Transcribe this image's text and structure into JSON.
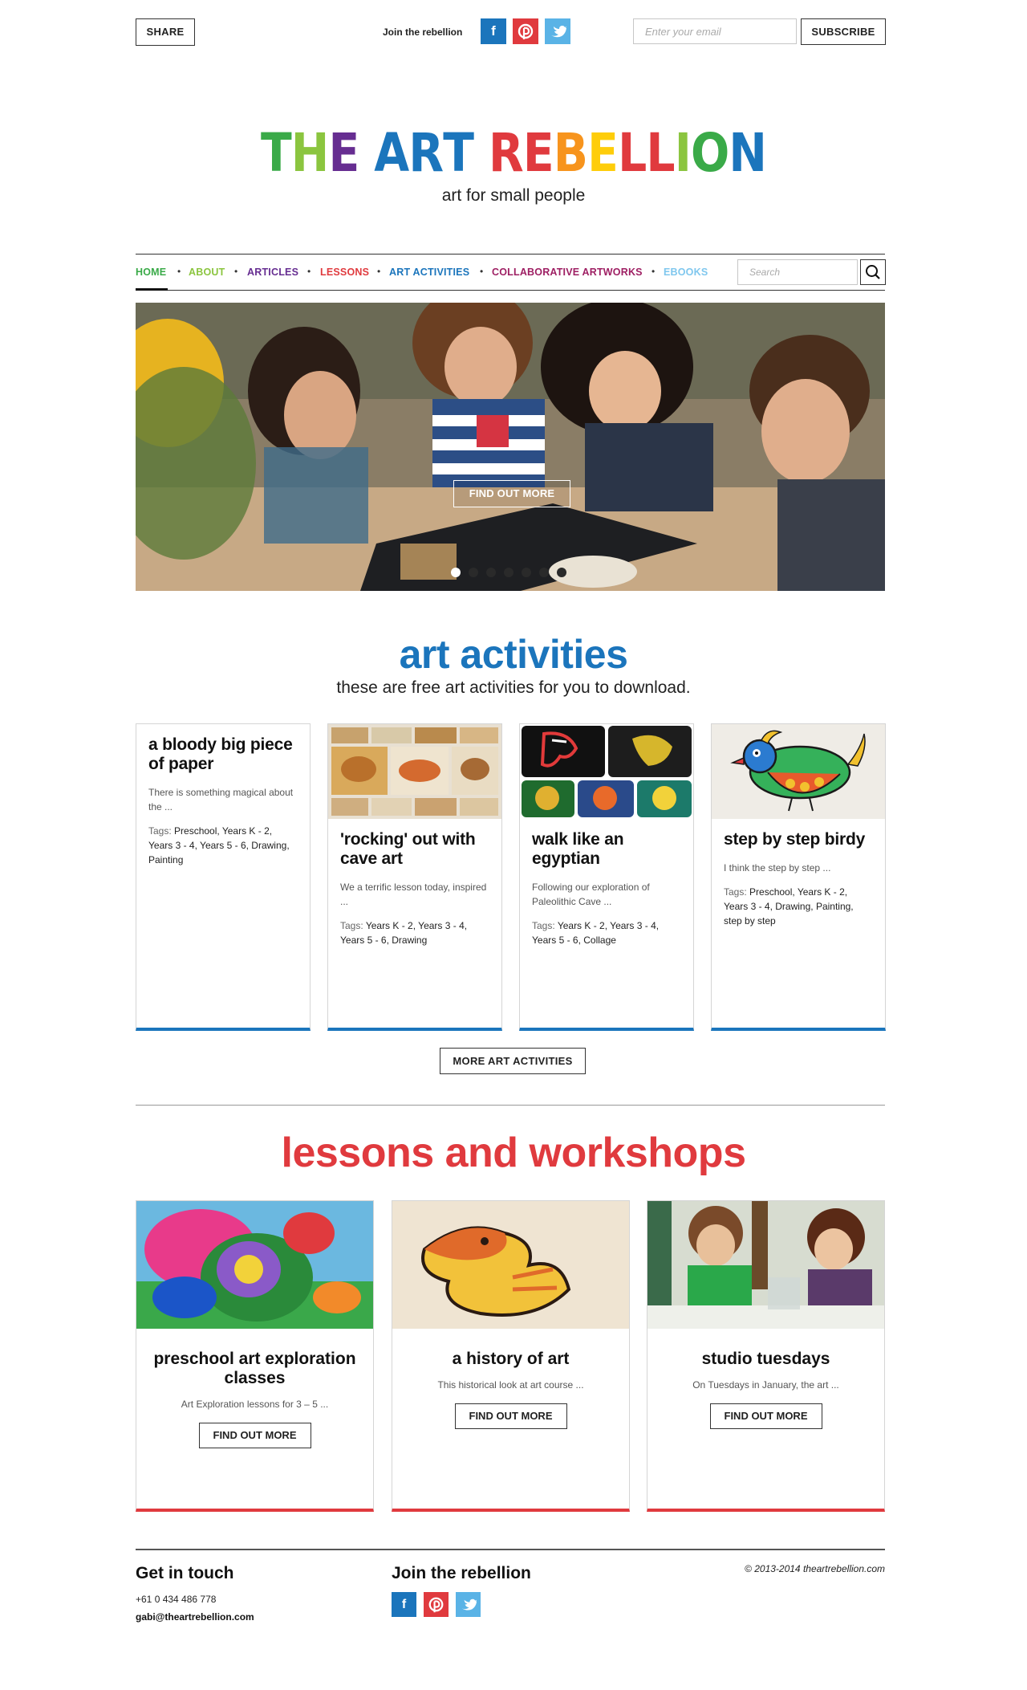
{
  "topbar": {
    "share_label": "SHARE",
    "join_text": "Join the rebellion",
    "social": {
      "facebook": "f",
      "pinterest": "℗",
      "twitter": "✦"
    },
    "email_placeholder": "Enter your email",
    "subscribe_label": "SUBSCRIBE"
  },
  "brand": {
    "logo_letters": [
      "T",
      "H",
      "E",
      " ",
      "A",
      "R",
      "T",
      " ",
      "R",
      "E",
      "B",
      "E",
      "L",
      "L",
      "I",
      "O",
      "N"
    ],
    "logo_colors": [
      "#3aaa48",
      "#8bc53f",
      "#662d91",
      "#ffffff",
      "#1b75bc",
      "#1b75bc",
      "#1b75bc",
      "#ffffff",
      "#e03a3e",
      "#e03a3e",
      "#f7941d",
      "#fecd0a",
      "#e03a3e",
      "#e03a3e",
      "#8bc53f",
      "#3aaa48",
      "#1b75bc"
    ],
    "tagline": "art for small people"
  },
  "nav": {
    "items": [
      {
        "label": "HOME",
        "color": "#3aaa48"
      },
      {
        "label": "ABOUT",
        "color": "#8bc53f"
      },
      {
        "label": "ARTICLES",
        "color": "#662d91"
      },
      {
        "label": "LESSONS",
        "color": "#e03a3e"
      },
      {
        "label": "ART ACTIVITIES",
        "color": "#1b75bc"
      },
      {
        "label": "COLLABORATIVE ARTWORKS",
        "color": "#9e1f63"
      },
      {
        "label": "EBOOKS",
        "color": "#7fc7ee"
      }
    ],
    "separator": "•",
    "search_placeholder": "Search"
  },
  "hero": {
    "button_label": "FIND OUT MORE",
    "slide_count": 7,
    "active_slide": 1
  },
  "art_activities": {
    "title": "art activities",
    "subtitle": "these are free art activities for you to download.",
    "tags_prefix": "Tags: ",
    "cards": [
      {
        "title": "a bloody big piece of paper",
        "excerpt": "There is something magical about the ...",
        "tags": "Preschool, Years K - 2, Years 3 - 4, Years 5 - 6, Drawing, Painting",
        "has_image": false
      },
      {
        "title": "'rocking' out with cave art",
        "excerpt": "We a terrific lesson today, inspired ...",
        "tags": "Years K - 2, Years 3 - 4, Years 5 - 6, Drawing",
        "has_image": true
      },
      {
        "title": "walk like an egyptian",
        "excerpt": "Following our exploration of Paleolithic Cave ...",
        "tags": "Years K - 2, Years 3 - 4, Years 5 - 6, Collage",
        "has_image": true
      },
      {
        "title": "step by step birdy",
        "excerpt": "I think the step by step ...",
        "tags": "Preschool, Years K - 2, Years 3 - 4, Drawing, Painting, step by step",
        "has_image": true
      }
    ],
    "more_label": "MORE ART ACTIVITIES"
  },
  "lessons": {
    "title": "lessons and workshops",
    "cards": [
      {
        "title": "preschool art exploration classes",
        "excerpt": "Art Exploration lessons for 3 – 5 ...",
        "button": "FIND OUT MORE"
      },
      {
        "title": "a history of art",
        "excerpt": "This historical look at art course ...",
        "button": "FIND OUT MORE"
      },
      {
        "title": "studio tuesdays",
        "excerpt": "On Tuesdays in January, the art ...",
        "button": "FIND OUT MORE"
      }
    ]
  },
  "footer": {
    "contact_heading": "Get in touch",
    "phone": "+61 0 434 486 778",
    "email": "gabi@theartrebellion.com",
    "join_heading": "Join the rebellion",
    "copyright": "© 2013-2014 theartrebellion.com"
  }
}
